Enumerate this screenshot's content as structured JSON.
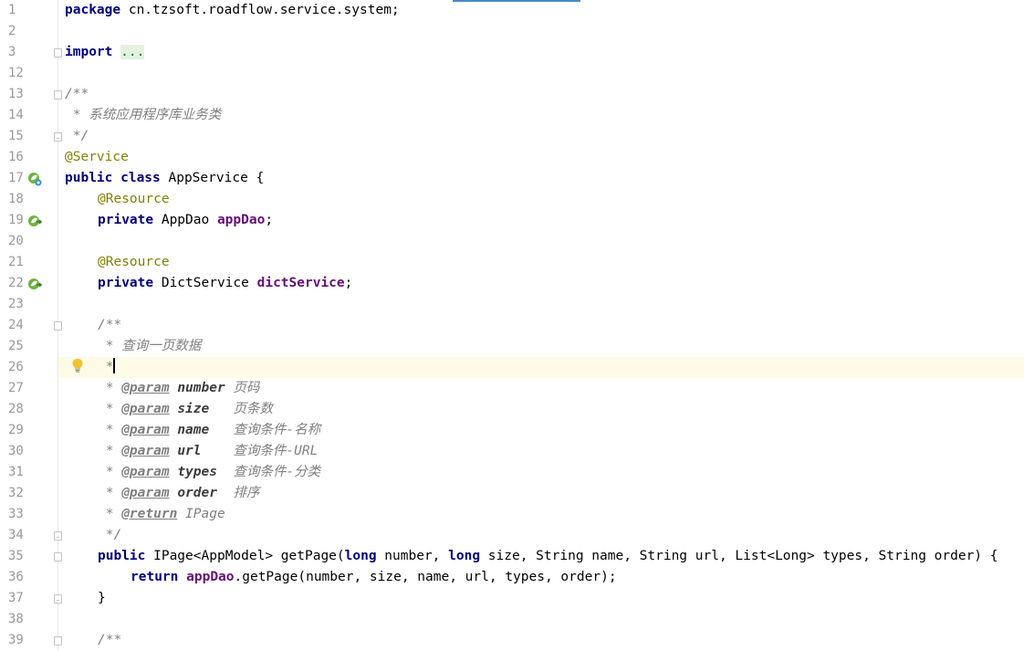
{
  "editor": {
    "line_numbers": [
      "1",
      "2",
      "3",
      "12",
      "13",
      "14",
      "15",
      "16",
      "17",
      "18",
      "19",
      "20",
      "21",
      "22",
      "23",
      "24",
      "25",
      "26",
      "27",
      "28",
      "29",
      "30",
      "31",
      "32",
      "33",
      "34",
      "35",
      "36",
      "37",
      "38",
      "39"
    ],
    "caret_line": "26",
    "code": {
      "l1_kw": "package",
      "l1_pkg": " cn.tzsoft.roadflow.service.system;",
      "l3_kw": "import",
      "l3_fold": "...",
      "l13": "/**",
      "l14": " * 系统应用程序库业务类",
      "l15": " */",
      "l16": "@Service",
      "l17_kw": "public class",
      "l17_name": " AppService {",
      "l18": "@Resource",
      "l19_kw": "private",
      "l19_type": " AppDao ",
      "l19_field": "appDao",
      "l19_semi": ";",
      "l21": "@Resource",
      "l22_kw": "private",
      "l22_type": " DictService ",
      "l22_field": "dictService",
      "l22_semi": ";",
      "l24": "/**",
      "l25": " * 查询一页数据",
      "l26": " *",
      "l27": {
        "star": " * ",
        "tag": "@param",
        "name": " number",
        "desc": " 页码"
      },
      "l28": {
        "star": " * ",
        "tag": "@param",
        "name": " size",
        "desc": "   页条数"
      },
      "l29": {
        "star": " * ",
        "tag": "@param",
        "name": " name",
        "desc": "   查询条件-名称"
      },
      "l30": {
        "star": " * ",
        "tag": "@param",
        "name": " url",
        "desc": "    查询条件-URL"
      },
      "l31": {
        "star": " * ",
        "tag": "@param",
        "name": " types",
        "desc": "  查询条件-分类"
      },
      "l32": {
        "star": " * ",
        "tag": "@param",
        "name": " order",
        "desc": "  排序"
      },
      "l33": {
        "star": " * ",
        "tag": "@return",
        "desc": " IPage"
      },
      "l34": " */",
      "l35_kw1": "public",
      "l35_a": " IPage<AppModel> getPage(",
      "l35_kw2": "long",
      "l35_b": " number, ",
      "l35_kw3": "long",
      "l35_c": " size, String name, String url, List<Long> types, String order) {",
      "l36_kw": "return",
      "l36_field": "appDao",
      "l36_rest": ".getPage(number, size, name, url, types, order);",
      "l37": "}",
      "l39": "/**"
    }
  },
  "colors": {
    "keyword": "#000080",
    "annotation": "#808000",
    "field": "#660e7a",
    "comment": "#808080",
    "caret_line_bg": "#fdfbe5"
  },
  "icons": {
    "gutter_17": "spring-bean-class-icon",
    "gutter_19": "spring-injection-icon",
    "gutter_22": "spring-injection-icon",
    "gutter_26": "intention-bulb-icon"
  }
}
